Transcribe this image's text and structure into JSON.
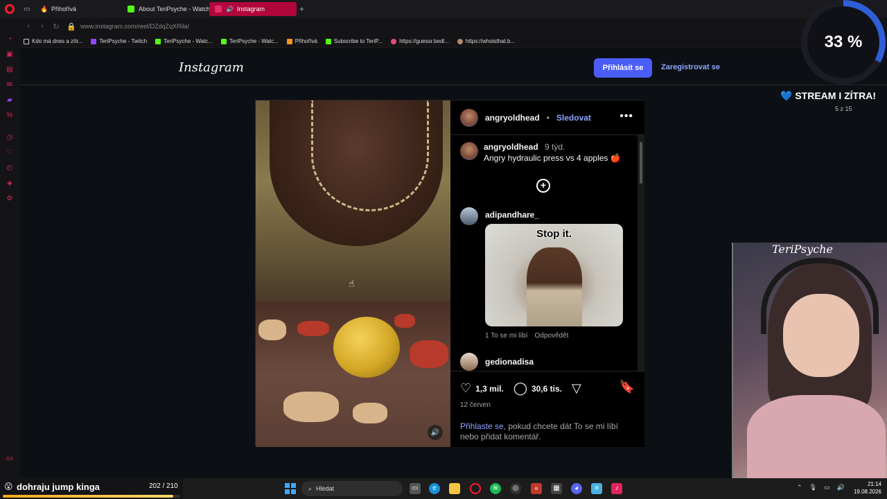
{
  "browser": {
    "tabs": [
      {
        "label": "Přihořívá",
        "icon": "fire-icon"
      },
      {
        "label": "About TeriPsyche - Watch",
        "icon": "kick-icon"
      },
      {
        "label": "Instagram",
        "icon": "instagram-icon",
        "active": true
      }
    ],
    "new_tab": "+",
    "url": "www.instagram.com/reel/DZdqZqXRila/",
    "bookmarks": [
      "Kdo má dnes a zítr...",
      "TeriPsyche - Twitch",
      "TeriPsyche - Watc...",
      "TeriPsyche - Watc...",
      "Přihořívá",
      "Subscribe to TeriP...",
      "https://guessr.bedl...",
      "https://whoisthat.b..."
    ],
    "sidebar_bottom": "GX"
  },
  "instagram": {
    "logo": "Instagram",
    "login_button": "Přihlásit se",
    "register_link": "Zaregistrovat se",
    "post": {
      "author": "angryoldhead",
      "separator": "•",
      "follow": "Sledovat",
      "more": "•••",
      "caption_time": "9 týd.",
      "caption_text": "Angry hydraulic press vs 4 apples 🍎",
      "comments": [
        {
          "user": "adipandhare_",
          "gif_text": "Stop it.",
          "likes": "1 To se mi líbí",
          "reply": "Odpovědět"
        },
        {
          "user": "gedionadisa"
        }
      ],
      "like_count": "1,3 mil.",
      "comment_count": "30,6 tis.",
      "date": "12 červen",
      "login_link": "Přihlaste se",
      "login_rest": ", pokud chcete dát To se mi líbí nebo přidat komentář."
    }
  },
  "overlay": {
    "progress_label": "33 %",
    "progress_value": 0.33,
    "stream_banner": "STREAM I ZÍTRA!",
    "stream_count": "5 z 15",
    "webcam_name": "TeriPsyche",
    "goal_text": "dohraju jump kinga",
    "goal_count": "202 / 210",
    "goal_value": 0.962
  },
  "taskbar": {
    "search_placeholder": "Hledat",
    "time": "21:14",
    "date": "19.08.2026"
  },
  "colors": {
    "accent_blue": "#4a5df9",
    "link_blue": "#8da5ff",
    "opera_red": "#ff1b2d",
    "active_tab": "#b1063b"
  }
}
